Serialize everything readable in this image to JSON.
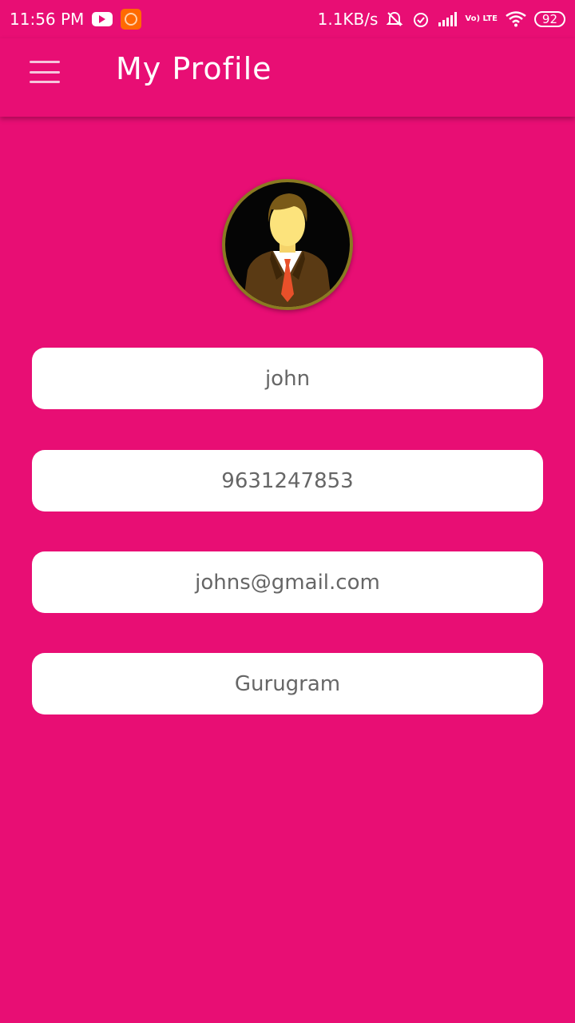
{
  "status_bar": {
    "time": "11:56 PM",
    "net_speed": "1.1KB/s",
    "volte": "Vo) LTE",
    "battery": "92"
  },
  "header": {
    "title": "My Profile"
  },
  "profile": {
    "name": "john",
    "phone": "9631247853",
    "email": "johns@gmail.com",
    "city": "Gurugram"
  },
  "colors": {
    "background": "#e80e74",
    "field_background": "#ffffff",
    "field_text": "#666666"
  }
}
